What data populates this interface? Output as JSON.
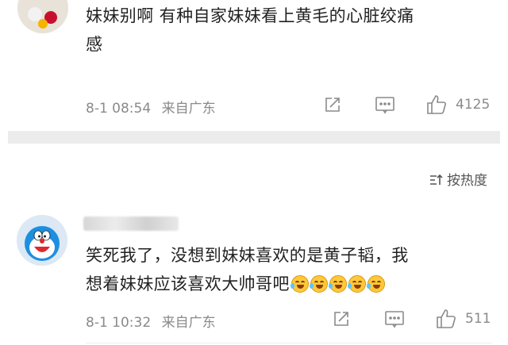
{
  "comments": [
    {
      "text_line1": "妹妹别啊 有种自家妹妹看上黄毛的心脏绞痛",
      "text_line2": "感",
      "date": "8-1 08:54",
      "location": "来自广东",
      "likes": "4125"
    },
    {
      "text_line1": "笑死我了，没想到妹妹喜欢的是黄子韬，我",
      "text_line2": "想着妹妹应该喜欢大帅哥吧",
      "emoji_count": 5,
      "emoji_icon": "laugh-cry-emoji",
      "date": "8-1 10:32",
      "location": "来自广东",
      "likes": "511"
    }
  ],
  "sort": {
    "label": "按热度",
    "icon": "sort-icon"
  },
  "icons": {
    "share": "share-icon",
    "comment": "comment-icon",
    "like": "thumbs-up-icon"
  },
  "colors": {
    "meta_text": "#8a8a8a",
    "separator_band": "#ececec",
    "body_text": "#222222"
  }
}
